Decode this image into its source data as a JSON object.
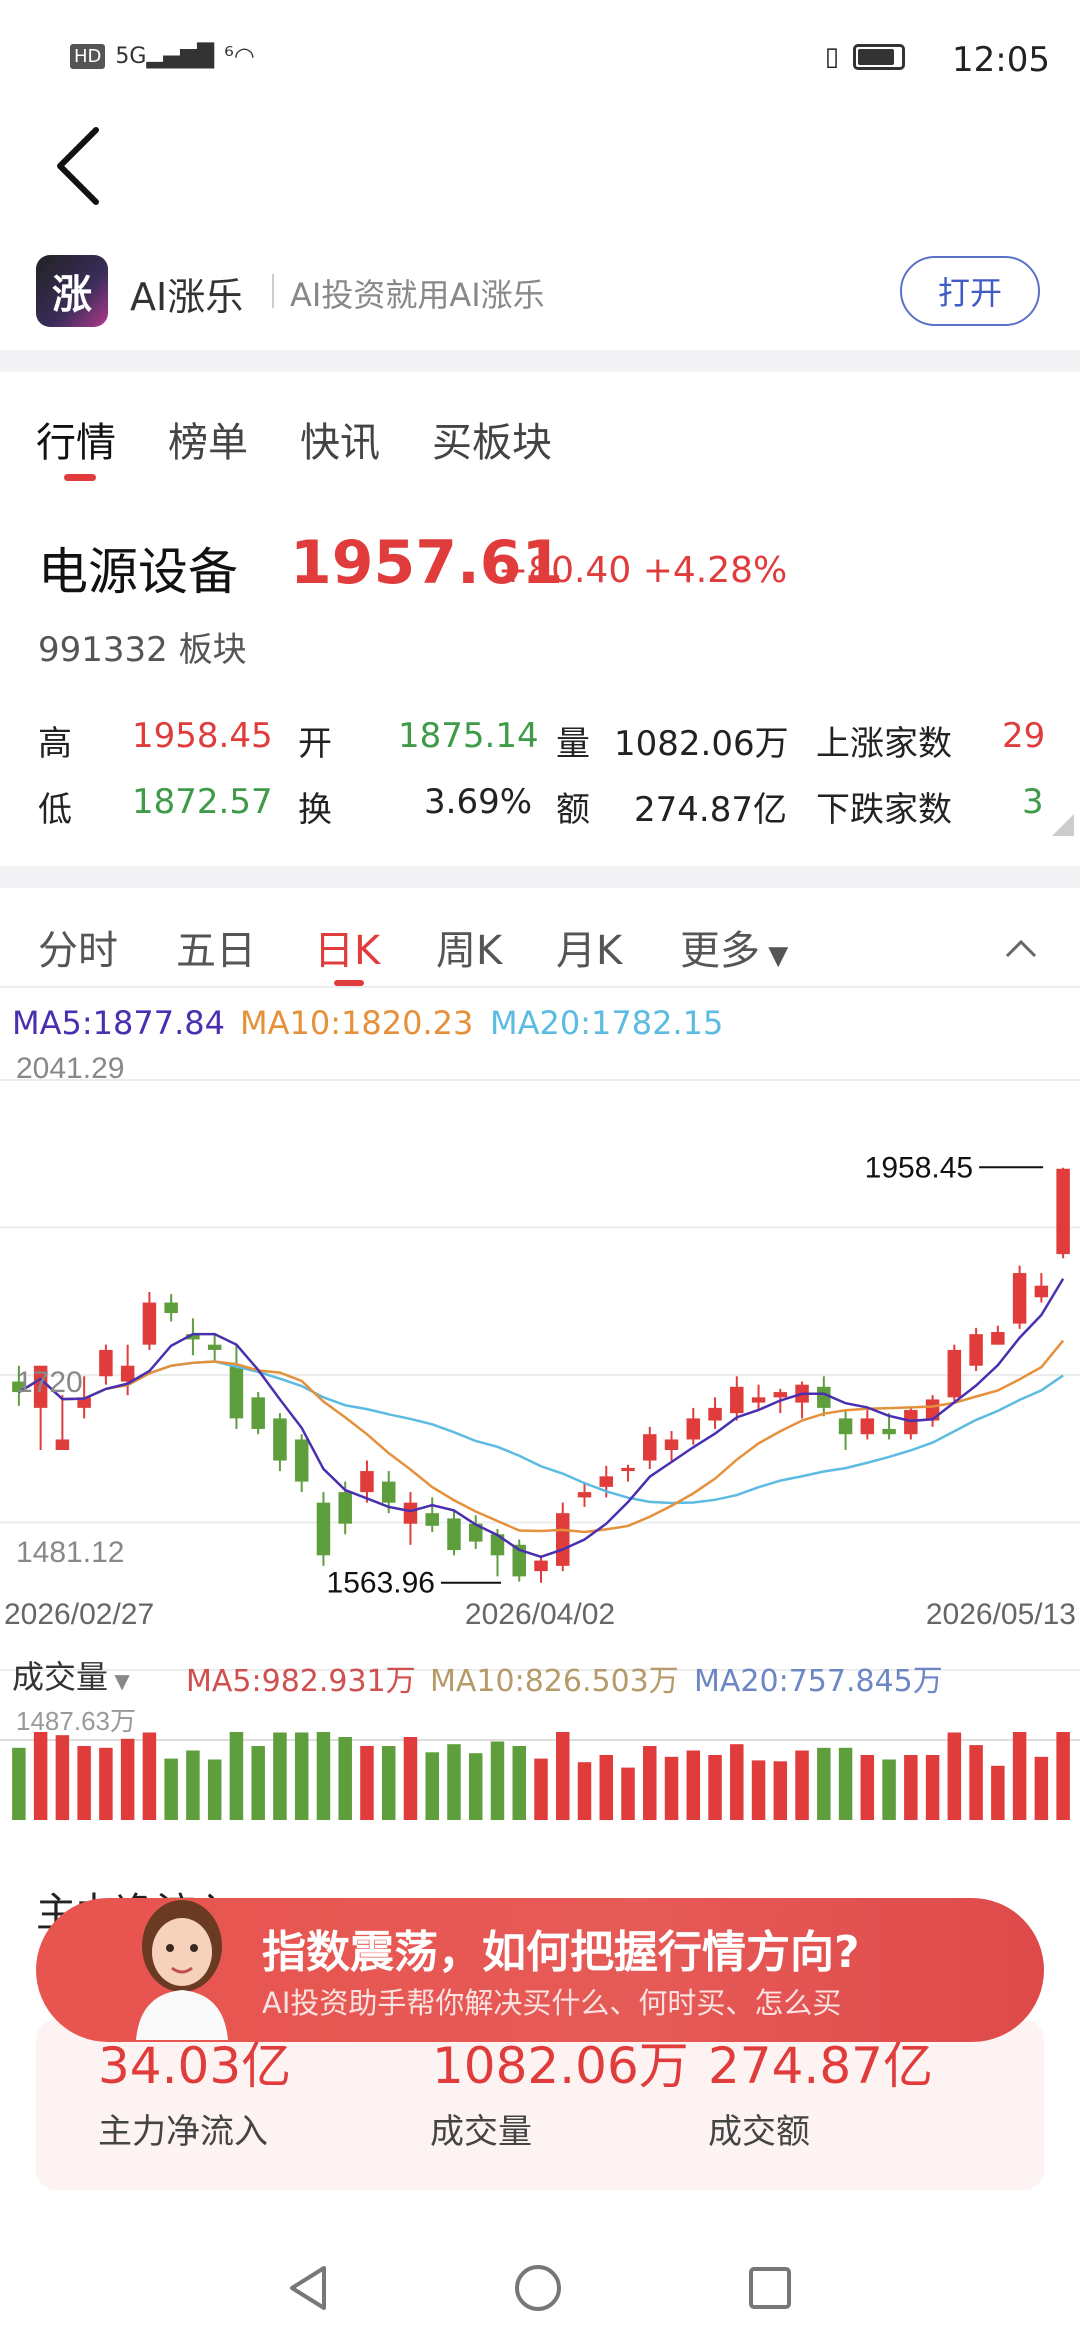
{
  "status_bar": {
    "left_icons": [
      "HD",
      "5G",
      "signal",
      "6",
      "wifi"
    ],
    "time": "12:05"
  },
  "app": {
    "name": "AI涨乐",
    "slogan": "AI投资就用AI涨乐",
    "open_label": "打开",
    "logo_glyph": "涨"
  },
  "main_tabs": [
    "行情",
    "榜单",
    "快讯",
    "买板块"
  ],
  "quote": {
    "name": "电源设备",
    "price": "1957.61",
    "change": "+80.40",
    "change_pct": "+4.28%",
    "code": "991332",
    "type": "板块",
    "high_label": "高",
    "high": "1958.45",
    "open_label": "开",
    "open": "1875.14",
    "vol_label": "量",
    "vol": "1082.06万",
    "up_label": "上涨家数",
    "up": "29",
    "low_label": "低",
    "low": "1872.57",
    "turnover_label": "换",
    "turnover": "3.69%",
    "amount_label": "额",
    "amount": "274.87亿",
    "down_label": "下跌家数",
    "down": "3"
  },
  "chart_tabs": [
    "分时",
    "五日",
    "日K",
    "周K",
    "月K",
    "更多"
  ],
  "ma": {
    "ma5": "MA5:1877.84",
    "ma10": "MA10:1820.23",
    "ma20": "MA20:1782.15"
  },
  "colors": {
    "up": "#e03c3c",
    "down": "#5f9e3c",
    "ma5": "#4a2fb0",
    "ma10": "#e5903a",
    "ma20": "#5bbbe0",
    "vol_ma10": "#b59b6a",
    "vol_ma20": "#6d86c6"
  },
  "chart_data": {
    "type": "candlestick",
    "y_top_label": "2041.29",
    "y_mid_label": "1720",
    "y_bottom_label": "1481.12",
    "ylim": [
      1481.12,
      2041.29
    ],
    "high_annotation": "1958.45",
    "low_annotation": "1563.96",
    "x_labels": [
      "2026/02/27",
      "2026/04/02",
      "2026/05/13"
    ],
    "ohlc": [
      [
        1755,
        1770,
        1732,
        1745
      ],
      [
        1730,
        1764,
        1690,
        1770
      ],
      [
        1690,
        1742,
        1690,
        1700
      ],
      [
        1730,
        1760,
        1720,
        1740
      ],
      [
        1760,
        1790,
        1752,
        1785
      ],
      [
        1755,
        1790,
        1742,
        1770
      ],
      [
        1790,
        1840,
        1785,
        1830
      ],
      [
        1830,
        1838,
        1812,
        1820
      ],
      [
        1800,
        1815,
        1780,
        1795
      ],
      [
        1790,
        1800,
        1775,
        1785
      ],
      [
        1770,
        1790,
        1710,
        1720
      ],
      [
        1740,
        1745,
        1705,
        1710
      ],
      [
        1720,
        1725,
        1670,
        1680
      ],
      [
        1700,
        1705,
        1650,
        1660
      ],
      [
        1640,
        1650,
        1580,
        1590
      ],
      [
        1650,
        1660,
        1610,
        1620
      ],
      [
        1650,
        1680,
        1640,
        1670
      ],
      [
        1660,
        1670,
        1630,
        1640
      ],
      [
        1620,
        1650,
        1600,
        1640
      ],
      [
        1630,
        1645,
        1612,
        1618
      ],
      [
        1625,
        1632,
        1590,
        1595
      ],
      [
        1620,
        1628,
        1596,
        1603
      ],
      [
        1610,
        1615,
        1570,
        1590
      ],
      [
        1600,
        1605,
        1565,
        1570
      ],
      [
        1575,
        1590,
        1564,
        1585
      ],
      [
        1580,
        1640,
        1575,
        1630
      ],
      [
        1645,
        1658,
        1636,
        1650
      ],
      [
        1655,
        1675,
        1645,
        1665
      ],
      [
        1670,
        1676,
        1660,
        1673
      ],
      [
        1680,
        1712,
        1672,
        1705
      ],
      [
        1690,
        1708,
        1680,
        1700
      ],
      [
        1700,
        1730,
        1695,
        1720
      ],
      [
        1718,
        1740,
        1710,
        1730
      ],
      [
        1725,
        1760,
        1718,
        1750
      ],
      [
        1735,
        1752,
        1728,
        1740
      ],
      [
        1740,
        1748,
        1725,
        1745
      ],
      [
        1735,
        1755,
        1720,
        1752
      ],
      [
        1750,
        1760,
        1722,
        1730
      ],
      [
        1720,
        1728,
        1690,
        1705
      ],
      [
        1705,
        1730,
        1700,
        1720
      ],
      [
        1710,
        1725,
        1700,
        1705
      ],
      [
        1705,
        1730,
        1700,
        1728
      ],
      [
        1718,
        1742,
        1712,
        1738
      ],
      [
        1740,
        1790,
        1735,
        1785
      ],
      [
        1770,
        1806,
        1765,
        1800
      ],
      [
        1790,
        1808,
        1790,
        1802
      ],
      [
        1810,
        1865,
        1805,
        1858
      ],
      [
        1835,
        1858,
        1830,
        1846
      ],
      [
        1876,
        1958,
        1872,
        1957
      ]
    ],
    "volume_ma": {
      "ma5": "MA5:982.931万",
      "ma10": "MA10:826.503万",
      "ma20": "MA20:757.845万"
    },
    "volume_max_label": "1487.63万"
  },
  "volume_label": "成交量",
  "banner": {
    "title": "指数震荡，如何把握行情方向?",
    "sub": "AI投资助手帮你解决买什么、何时买、怎么买"
  },
  "flows": {
    "section": "主力净流入",
    "inflow": "34.03亿",
    "inflow_label": "主力净流入",
    "vol": "1082.06万",
    "vol_label": "成交量",
    "amount": "274.87亿",
    "amount_label": "成交额"
  }
}
